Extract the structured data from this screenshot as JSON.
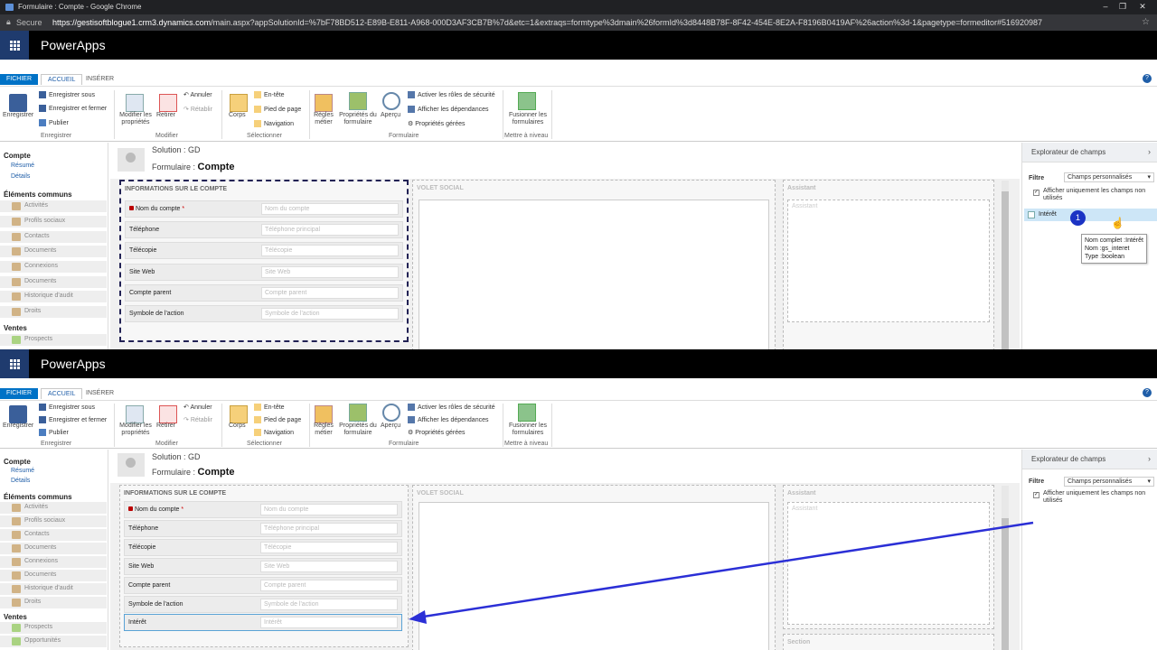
{
  "browser": {
    "title": "Formulaire : Compte - Google Chrome",
    "secure_label": "Secure",
    "url_host": "https://gestisoftblogue1.crm3.dynamics.com",
    "url_rest": "/main.aspx?appSolutionId=%7bF78BD512-E89B-E811-A968-000D3AF3CB7B%7d&etc=1&extraqs=formtype%3dmain%26formId%3d8448B78F-8F42-454E-8E2A-F8196B0419AF%26action%3d-1&pagetype=formeditor#516920987"
  },
  "app": {
    "name": "PowerApps"
  },
  "ribbon": {
    "tabs": {
      "fichier": "FICHIER",
      "accueil": "ACCUEIL",
      "inserer": "INSÉRER"
    },
    "help": "?",
    "enregistrer": "Enregistrer",
    "enregistrer_sous": "Enregistrer sous",
    "enregistrer_fermer": "Enregistrer et fermer",
    "publier": "Publier",
    "group_enregistrer": "Enregistrer",
    "modifier_proprietes": "Modifier les propriétés",
    "retirer": "Retirer",
    "annuler": "Annuler",
    "retablir": "Rétablir",
    "group_modifier": "Modifier",
    "corps": "Corps",
    "en_tete": "En-tête",
    "pied_page": "Pied de page",
    "navigation": "Navigation",
    "group_selectionner": "Sélectionner",
    "regles_metier": "Règles métier",
    "proprietes_formulaire": "Propriétés du formulaire",
    "apercu": "Aperçu",
    "activer_roles": "Activer les rôles de sécurité",
    "afficher_dependances": "Afficher les dépendances",
    "proprietes_gerees": "Propriétés gérées",
    "group_formulaire": "Formulaire",
    "fusionner": "Fusionner les formulaires",
    "group_mettre_niveau": "Mettre à niveau"
  },
  "nav": {
    "compte": "Compte",
    "resume": "Résumé",
    "details": "Détails",
    "elements_communs": "Éléments communs",
    "items": [
      "Activités",
      "Profils sociaux",
      "Contacts",
      "Documents",
      "Connexions",
      "Documents",
      "Historique d'audit",
      "Droits"
    ],
    "ventes": "Ventes",
    "prospects": "Prospects",
    "opportunites": "Opportunités"
  },
  "solution": {
    "prefix": "Solution :",
    "name": "GD",
    "form_prefix": "Formulaire :",
    "form_name": "Compte"
  },
  "section": {
    "title": "INFORMATIONS SUR LE COMPTE",
    "fields": [
      {
        "label": "Nom du compte",
        "placeholder": "Nom du compte",
        "required": "*"
      },
      {
        "label": "Téléphone",
        "placeholder": "Téléphone principal"
      },
      {
        "label": "Télécopie",
        "placeholder": "Télécopie"
      },
      {
        "label": "Site Web",
        "placeholder": "Site Web"
      },
      {
        "label": "Compte parent",
        "placeholder": "Compte parent"
      },
      {
        "label": "Symbole de l'action",
        "placeholder": "Symbole de l'action"
      }
    ],
    "new_field": {
      "label": "Intérêt",
      "placeholder": "Intérêt"
    },
    "volet_social": "VOLET SOCIAL",
    "assistant": "Assistant",
    "section_label": "Section"
  },
  "explorer": {
    "title": "Explorateur de champs",
    "filter_label": "Filtre",
    "filter_value": "Champs personnalisés",
    "checkbox_label": "Afficher uniquement les champs non utilisés",
    "field_name": "Intérêt",
    "badge": "1",
    "tooltip": [
      "Nom complet :Intérêt",
      "Nom :gs_interet",
      "Type :boolean"
    ]
  },
  "colors": {
    "accent": "#0072c6",
    "arrow": "#2b2fd6",
    "badge": "#1b33c4",
    "highlight": "#cde6f7"
  }
}
